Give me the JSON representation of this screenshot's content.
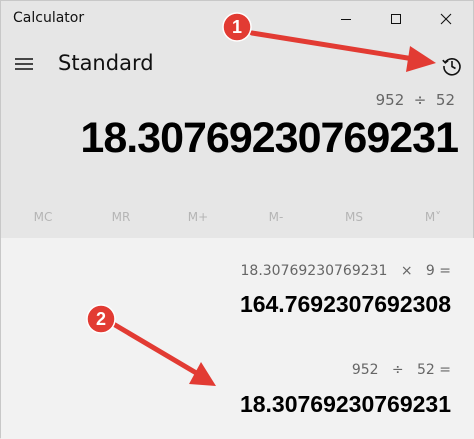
{
  "window": {
    "title": "Calculator",
    "minimize_icon": "minimize-icon",
    "maximize_icon": "maximize-icon",
    "close_icon": "close-icon"
  },
  "header": {
    "menu_icon": "hamburger-icon",
    "mode": "Standard",
    "history_icon": "history-icon"
  },
  "display": {
    "expression": "952  ÷  52",
    "result": "18.30769230769231"
  },
  "memory": {
    "buttons": [
      "MC",
      "MR",
      "M+",
      "M-",
      "MS",
      "M˅"
    ]
  },
  "history": {
    "items": [
      {
        "expression": "18.30769230769231   ×   9 =",
        "result": "164.7692307692308"
      },
      {
        "expression": "952   ÷   52 =",
        "result": "18.30769230769231"
      }
    ]
  },
  "annotations": {
    "badges": [
      "1",
      "2"
    ],
    "color": "#e23b33"
  }
}
